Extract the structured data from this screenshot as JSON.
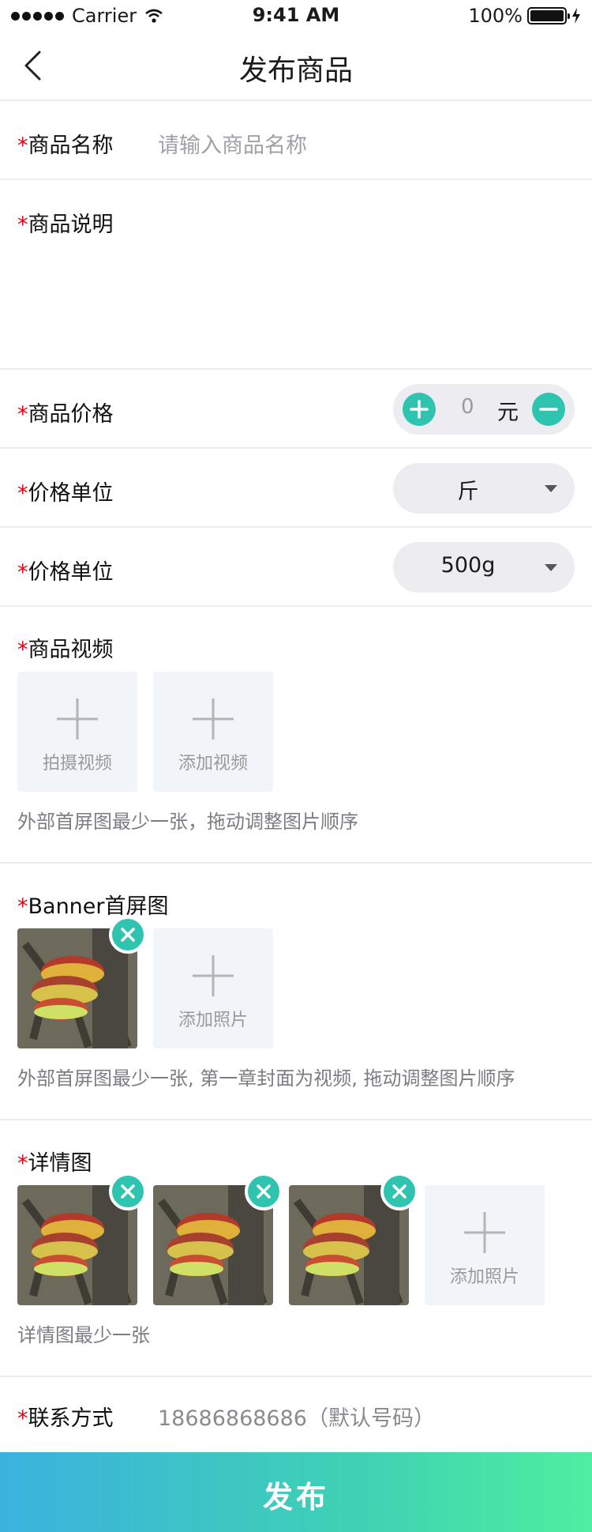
{
  "status_bar": {
    "carrier": "Carrier",
    "time": "9:41 AM",
    "battery": "100%"
  },
  "nav": {
    "title": "发布商品"
  },
  "required_mark": "*",
  "product_name": {
    "label": "商品名称",
    "placeholder": "请输入商品名称"
  },
  "description": {
    "label": "商品说明"
  },
  "price": {
    "label": "商品价格",
    "value": "0",
    "unit": "元"
  },
  "unit_select_1": {
    "label": "价格单位",
    "value": "斤"
  },
  "unit_select_2": {
    "label": "价格单位",
    "value": "500g"
  },
  "video": {
    "label": "商品视频",
    "shoot_label": "拍摄视频",
    "add_label": "添加视频",
    "hint": "外部首屏图最少一张，拖动调整图片顺序"
  },
  "banner": {
    "label": "Banner首屏图",
    "add_label": "添加照片",
    "hint": "外部首屏图最少一张, 第一章封面为视频, 拖动调整图片顺序"
  },
  "detail": {
    "label": "详情图",
    "add_label": "添加照片",
    "hint": "详情图最少一张"
  },
  "contact": {
    "label": "联系方式",
    "value": "18686868686（默认号码）"
  },
  "publish_label": "发布",
  "colors": {
    "accent": "#2ec4b0",
    "required": "#e60012",
    "gradient_start": "#3bb2de",
    "gradient_end": "#4eeea0"
  }
}
